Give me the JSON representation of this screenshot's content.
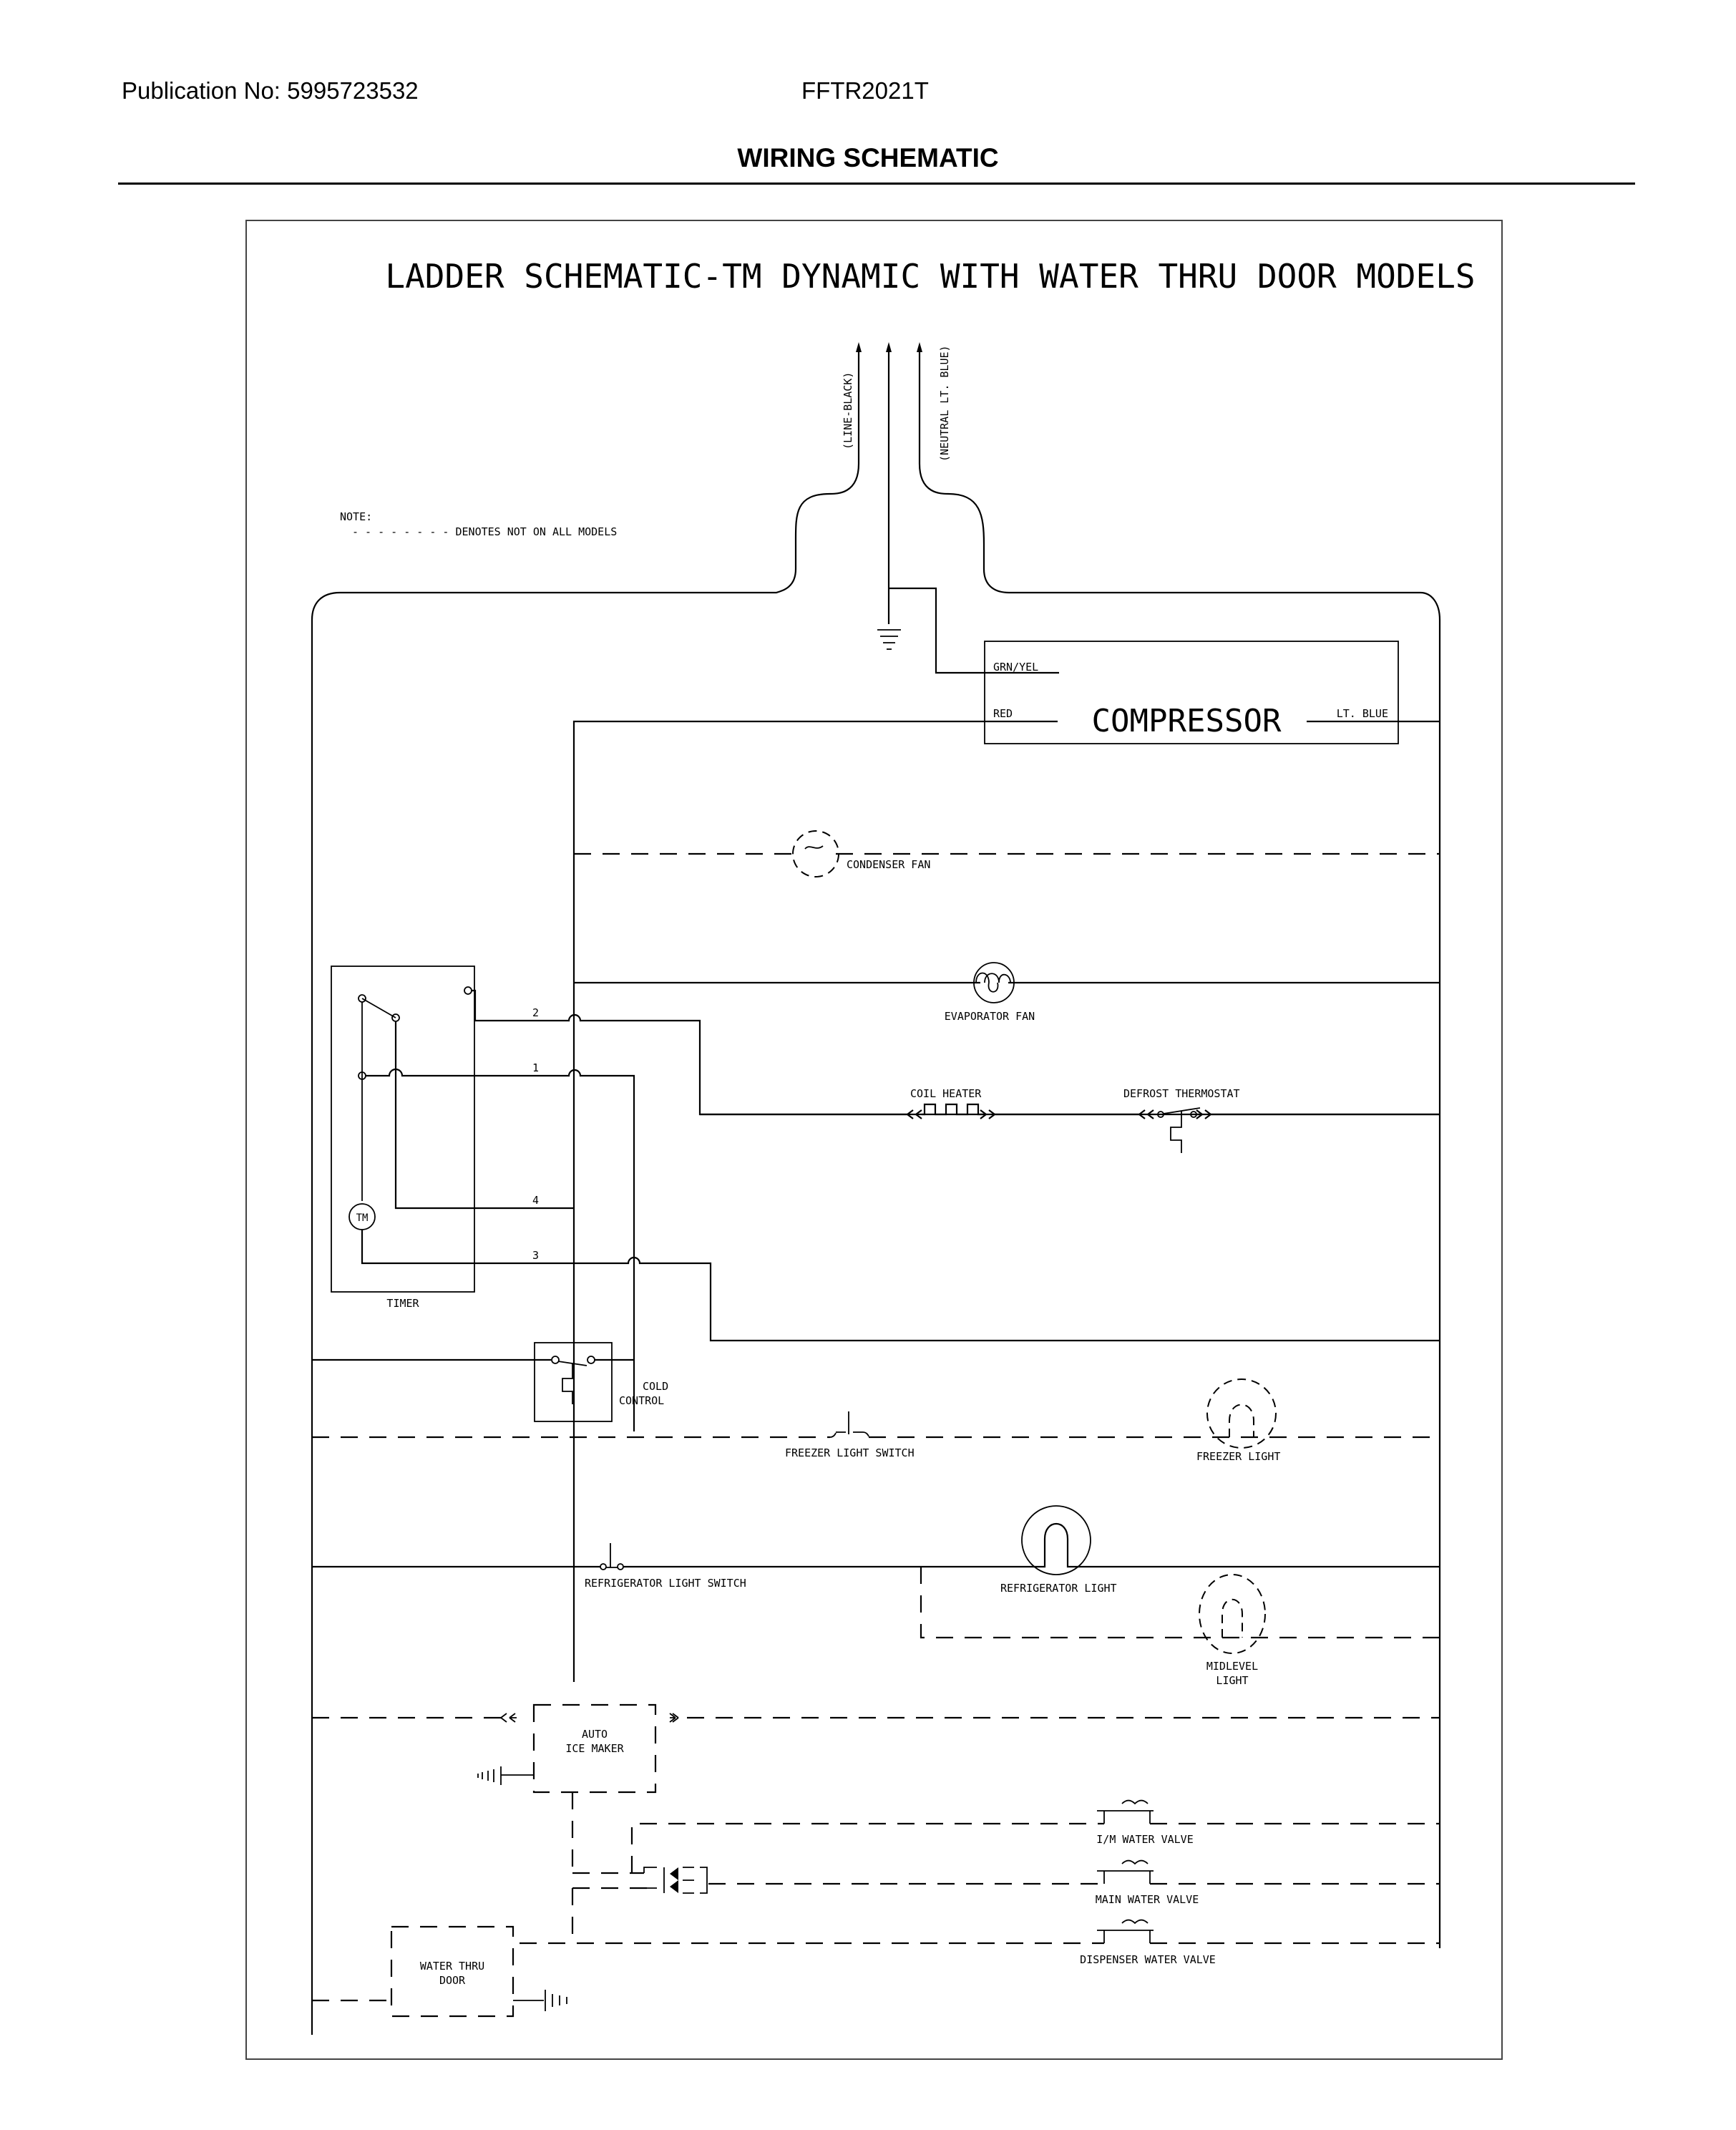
{
  "header": {
    "publication": "Publication No: 5995723532",
    "model": "FFTR2021T",
    "page_title": "WIRING SCHEMATIC"
  },
  "schematic": {
    "title": "LADDER SCHEMATIC-TM DYNAMIC WITH WATER THRU DOOR MODELS",
    "note_label": "NOTE:",
    "note_text": "- - - - - - - - DENOTES NOT ON ALL MODELS",
    "supply": {
      "line": "(LINE-BLACK)",
      "neutral": "(NEUTRAL LT. BLUE)"
    },
    "compressor": {
      "label": "COMPRESSOR",
      "wire_ground": "GRN/YEL",
      "wire_line": "RED",
      "wire_neutral": "LT. BLUE"
    },
    "timer": {
      "label": "TIMER",
      "motor": "TM",
      "terminals": [
        "2",
        "1",
        "4",
        "3"
      ]
    },
    "components": {
      "condenser_fan": "CONDENSER FAN",
      "evaporator_fan": "EVAPORATOR FAN",
      "coil_heater": "COIL HEATER",
      "defrost_thermostat": "DEFROST THERMOSTAT",
      "cold_control_1": "COLD",
      "cold_control_2": "CONTROL",
      "freezer_light_switch": "FREEZER LIGHT SWITCH",
      "freezer_light": "FREEZER LIGHT",
      "refrigerator_light_switch": "REFRIGERATOR LIGHT SWITCH",
      "refrigerator_light": "REFRIGERATOR LIGHT",
      "midlevel_light_1": "MIDLEVEL",
      "midlevel_light_2": "LIGHT",
      "ice_maker_1": "AUTO",
      "ice_maker_2": "ICE MAKER",
      "im_water_valve": "I/M WATER VALVE",
      "main_water_valve": "MAIN WATER VALVE",
      "dispenser_water_valve": "DISPENSER WATER VALVE",
      "water_thru_door_1": "WATER THRU",
      "water_thru_door_2": "DOOR"
    }
  }
}
